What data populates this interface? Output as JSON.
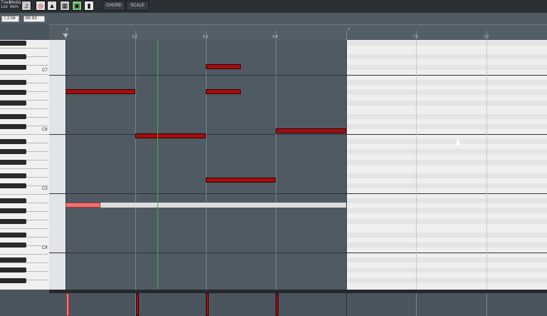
{
  "toolbar": {
    "track_list": "Track\nList",
    "media_item": "Media\nItem",
    "chord_label": "CHORD",
    "scale_label": "SCALE"
  },
  "infobar": {
    "position": "7.2.56",
    "note": "B5  83"
  },
  "ruler": {
    "labels": [
      "6",
      "6.2",
      "6.3",
      "6.4",
      "7",
      "7.2",
      "7.3"
    ]
  },
  "keyboard": {
    "labels": [
      "C7",
      "C6",
      "C5",
      "C4"
    ]
  },
  "colors": {
    "note_fill": "#a30e0e",
    "note_selected": "#f07474",
    "edit_cursor": "#4aa84f"
  }
}
